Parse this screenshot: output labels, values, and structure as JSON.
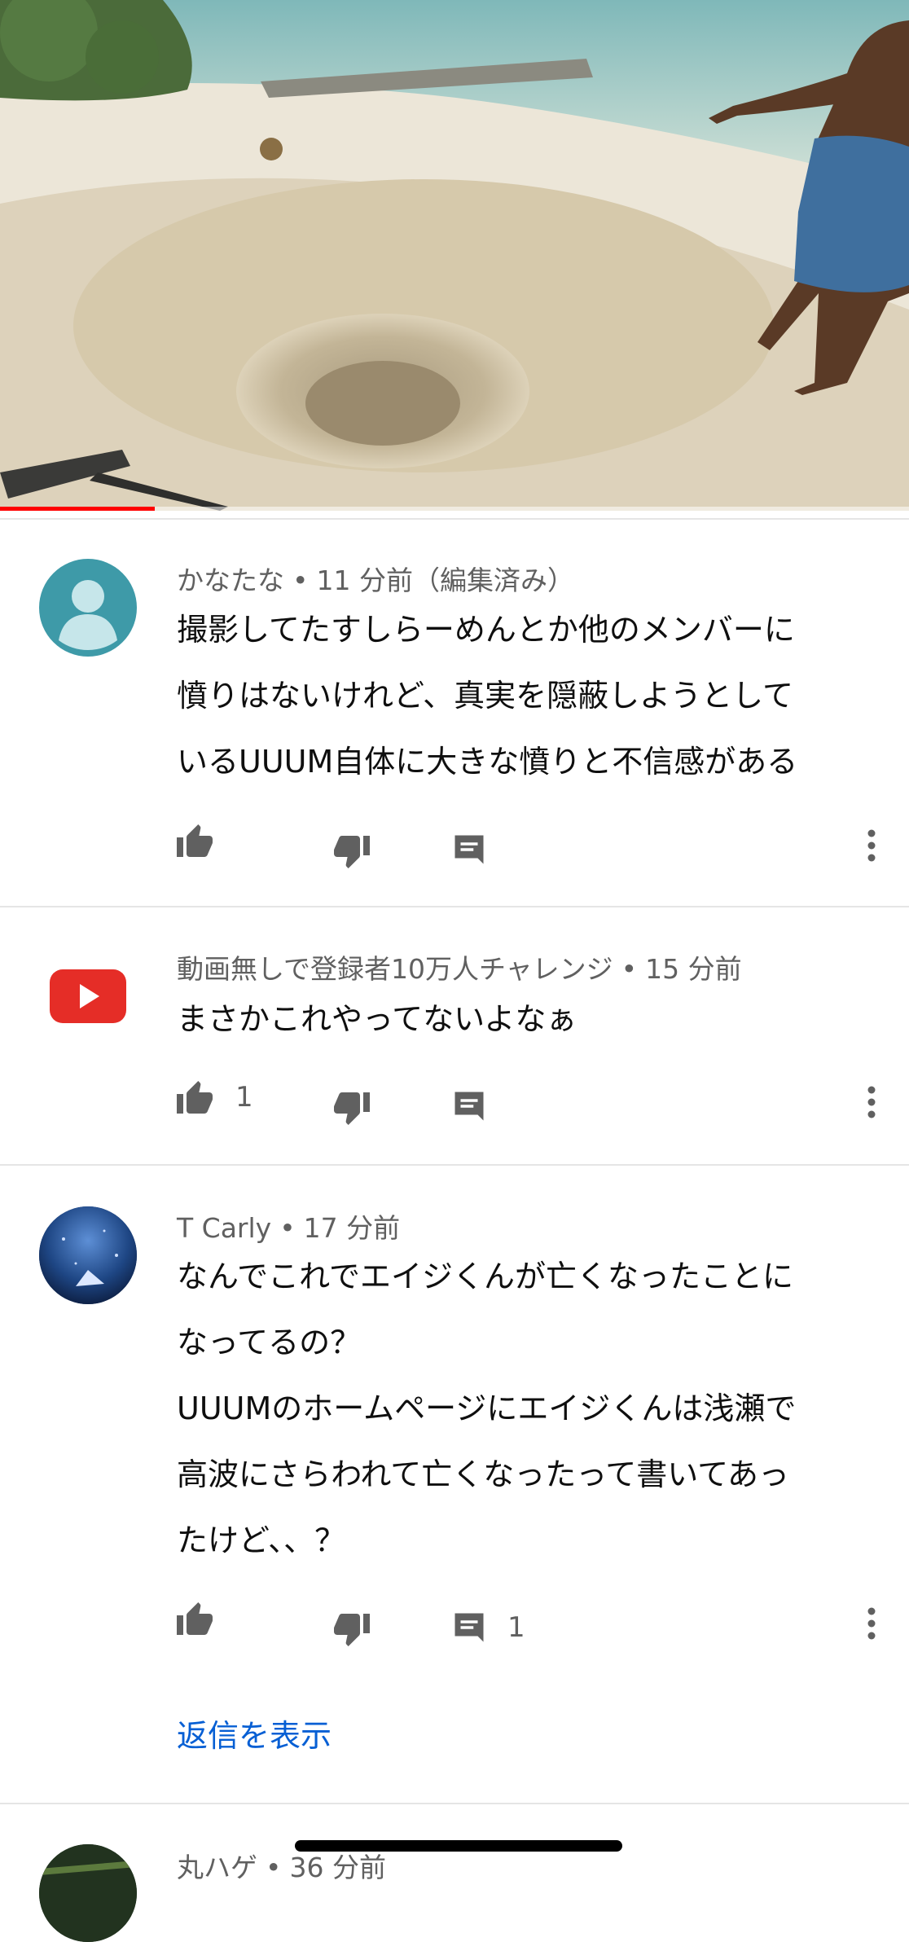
{
  "video": {
    "progress_percent": 17
  },
  "comments": [
    {
      "author": "かなたな",
      "time": "11 分前（編集済み）",
      "lines": [
        "撮影してたすしらーめんとか他のメンバーに",
        "憤りはないけれど、真実を隠蔽しようとして",
        "いるUUUM自体に大きな憤りと不信感がある"
      ],
      "likes": "",
      "replies": ""
    },
    {
      "author": "動画無しで登録者10万人チャレンジ",
      "time": "15 分前",
      "lines": [
        "まさかこれやってないよなぁ"
      ],
      "likes": "1",
      "replies": ""
    },
    {
      "author": "T Carly",
      "time": "17 分前",
      "lines": [
        "なんでこれでエイジくんが亡くなったことに",
        "なってるの？",
        "UUUMのホームページにエイジくんは浅瀬で",
        "高波にさらわれて亡くなったって書いてあっ",
        "たけど、、？"
      ],
      "likes": "",
      "replies": "1",
      "show_replies_label": "返信を表示"
    },
    {
      "author": "丸ハゲ",
      "time": "36 分前"
    }
  ],
  "meta_separator": "•",
  "icons": {
    "like": "thumbs-up-icon",
    "dislike": "thumbs-down-icon",
    "reply": "comment-icon",
    "more": "more-vert-icon",
    "default_avatar": "person-avatar-icon",
    "youtube_avatar": "youtube-logo-icon"
  },
  "colors": {
    "progress": "#ff0000",
    "link": "#065fd4",
    "meta_text": "#606060",
    "icon": "#606060",
    "default_avatar_bg": "#3e9aa8",
    "youtube_red": "#e52d27"
  }
}
